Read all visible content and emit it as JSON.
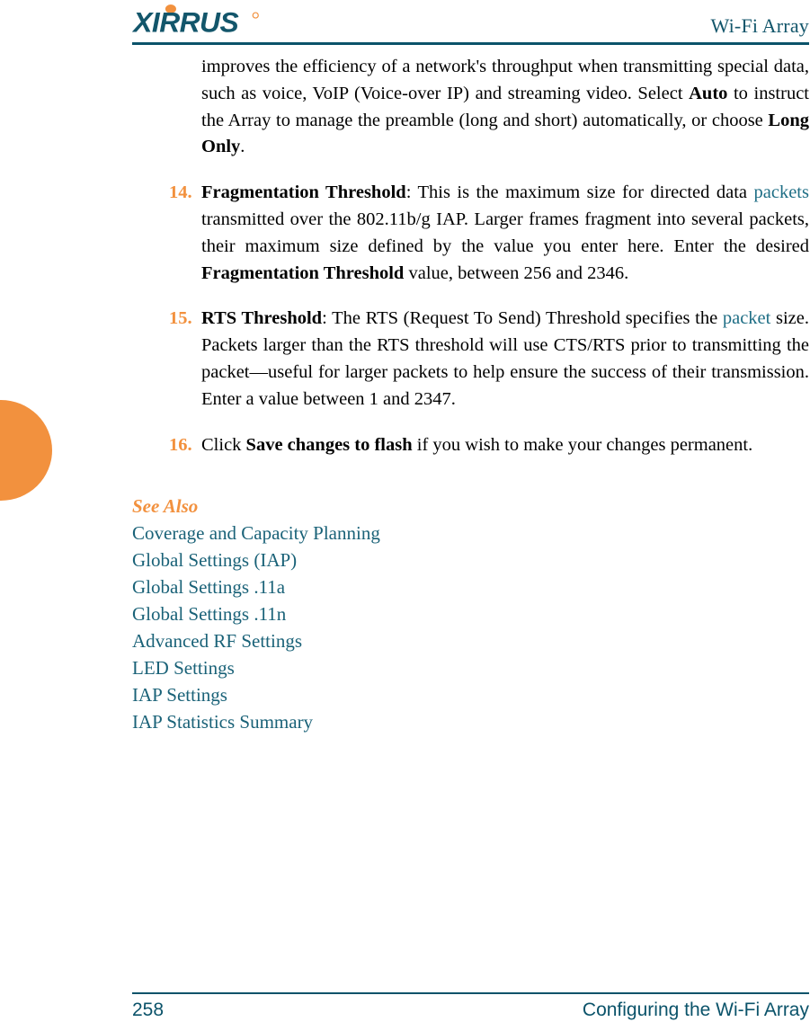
{
  "header": {
    "logo_text": "XIRRUS",
    "logo_icon": "xirrus-logo",
    "title": "Wi-Fi Array",
    "logo_color": "#13566B",
    "dot_color": "#F2913E",
    "rule_color": "#0B536A"
  },
  "colors": {
    "accent_orange": "#F2913E",
    "link_teal": "#1A6278",
    "rule_teal": "#0B536A"
  },
  "decoration": {
    "left_tab_name": "orange-page-tab",
    "left_tab_color": "#F2913E"
  },
  "content": {
    "intro_paragraph": {
      "segment_1": "improves the efficiency of a network's throughput when transmitting special data, such as voice, VoIP (Voice-over IP) and streaming video. Select ",
      "bold_1": "Auto",
      "segment_2": " to instruct the Array to manage the preamble (long and short) automatically, or choose ",
      "bold_2": "Long Only",
      "segment_3": "."
    },
    "list_items": [
      {
        "number": "14.",
        "bold_lead": "Fragmentation Threshold",
        "segment_1": ": This is the maximum size for directed data ",
        "link_text": "packets",
        "segment_2": " transmitted over the 802.11b/g IAP. Larger frames fragment into several packets, their maximum size defined by the value you enter here. Enter the desired ",
        "bold_2": "Fragmentation Threshold",
        "segment_3": " value, between 256 and 2346."
      },
      {
        "number": "15.",
        "bold_lead": "RTS Threshold",
        "segment_1": ": The RTS (Request To Send) Threshold specifies the ",
        "link_text": "packet",
        "segment_2": " size. Packets larger than the RTS threshold will use CTS/RTS prior to transmitting the packet—useful for larger packets to help ensure the success of their transmission. Enter a value between 1 and 2347.",
        "bold_2": "",
        "segment_3": ""
      },
      {
        "number": "16.",
        "bold_lead": "",
        "segment_1": "Click ",
        "link_text": "",
        "segment_2": "",
        "bold_2": "Save changes to flash",
        "segment_3": " if you wish to make your changes permanent."
      }
    ],
    "see_also": {
      "heading": "See Also",
      "links": [
        "Coverage and Capacity Planning",
        "Global Settings (IAP)",
        "Global Settings .11a",
        "Global Settings .11n",
        "Advanced RF Settings",
        "LED Settings",
        "IAP Settings",
        "IAP Statistics Summary"
      ]
    }
  },
  "footer": {
    "page_number": "258",
    "chapter_title": "Configuring the Wi-Fi Array"
  }
}
